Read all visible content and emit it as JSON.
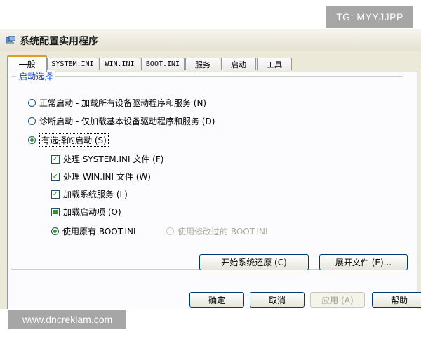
{
  "watermarks": {
    "top": "TG: MYYJJPP",
    "bottom": "www.dncreklam.com"
  },
  "window": {
    "title": "系统配置实用程序"
  },
  "tabs": [
    {
      "label": "一般",
      "active": true
    },
    {
      "label": "SYSTEM.INI"
    },
    {
      "label": "WIN.INI"
    },
    {
      "label": "BOOT.INI"
    },
    {
      "label": "服务"
    },
    {
      "label": "启动"
    },
    {
      "label": "工具"
    }
  ],
  "startup": {
    "group_label": "启动选择",
    "normal": "正常启动 - 加载所有设备驱动程序和服务 (N)",
    "diagnostic": "诊断启动 - 仅加载基本设备驱动程序和服务 (D)",
    "selective": "有选择的启动 (S)",
    "selected_option": "selective",
    "process_system_ini": "处理 SYSTEM.INI 文件 (F)",
    "process_win_ini": "处理 WIN.INI 文件 (W)",
    "load_services": "加载系统服务 (L)",
    "load_startup_items": "加载启动项 (O)",
    "use_original_boot": "使用原有 BOOT.INI",
    "use_modified_boot": "使用修改过的 BOOT.INI",
    "checks": {
      "system_ini": true,
      "win_ini": true,
      "services": true,
      "startup_items": "indeterminate"
    }
  },
  "actions": {
    "restore": "开始系统还原 (C)",
    "expand": "展开文件 (E)..."
  },
  "footer": {
    "ok": "确定",
    "cancel": "取消",
    "apply": "应用 (A)",
    "help": "帮助"
  },
  "icons": {
    "app": "msconfig-app-icon"
  },
  "colors": {
    "accent_tab": "#e69c24",
    "check": "#21a121",
    "group_label": "#0046d5"
  }
}
